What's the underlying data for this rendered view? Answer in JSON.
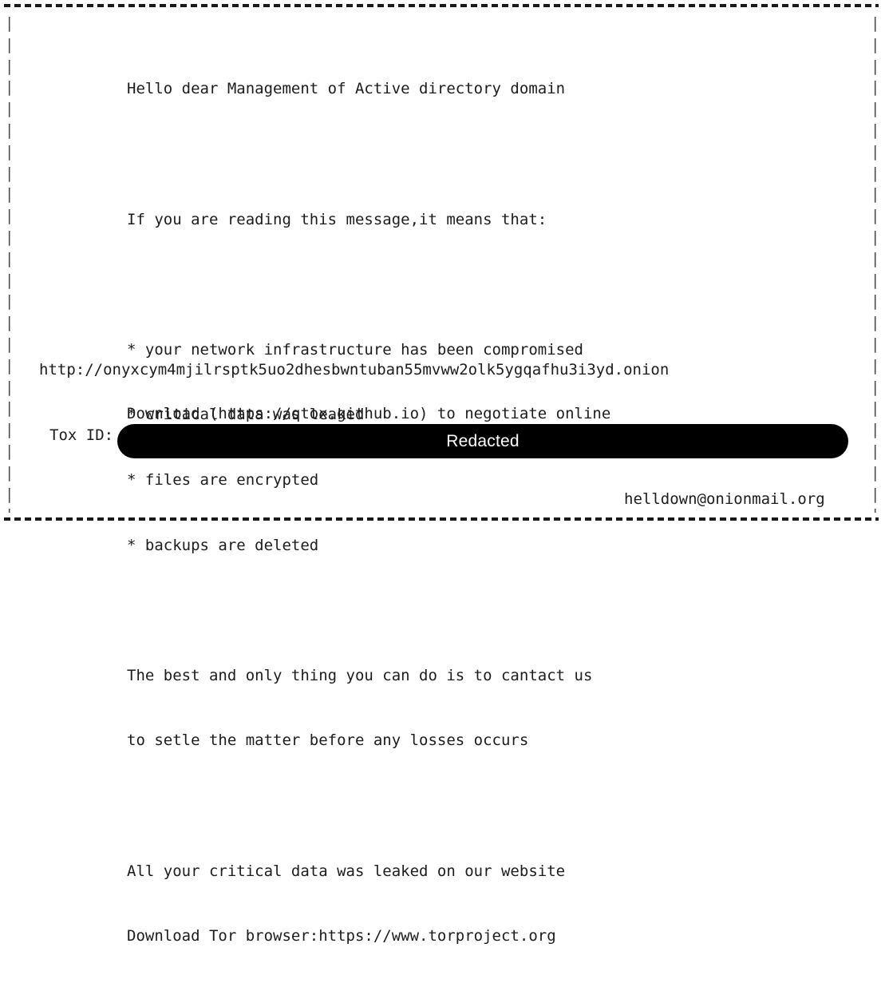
{
  "note": {
    "greeting": "Hello dear Management of Active directory domain",
    "intro": "If you are reading this message,it means that:",
    "bullets": [
      "* your network infrastructure has been compromised",
      "* critical data was leaked",
      "* files are encrypted",
      "* backups are deleted"
    ],
    "contact_lines": [
      "The best and only thing you can do is to cantact us",
      "to setle the matter before any losses occurs"
    ],
    "leak_lines": [
      "All your critical data was leaked on our website",
      "Download Tor browser:https://www.torproject.org"
    ],
    "onion_url": "http://onyxcym4mjilrsptk5uo2dhesbwntuban55mvww2olk5ygqafhu3i3yd.onion",
    "qtox_line": "Download (https://qtox.github.io) to negotiate online",
    "tox_id_label": "Tox ID:",
    "tox_id_value": "Redacted",
    "email": "helldown@onionmail.org",
    "border": {
      "horizontal_char": "-",
      "vertical_char": "|",
      "vertical_repeat": "|\n|\n|\n|\n|\n|\n|\n|\n|\n|\n|\n|\n|\n|\n|\n|\n|\n|\n|\n|\n|\n|\n|\n|"
    },
    "colors": {
      "text": "#1c1c1c",
      "background": "#ffffff",
      "redaction": "#000000",
      "redaction_text": "#ffffff",
      "border": "#4a4a4a"
    }
  }
}
